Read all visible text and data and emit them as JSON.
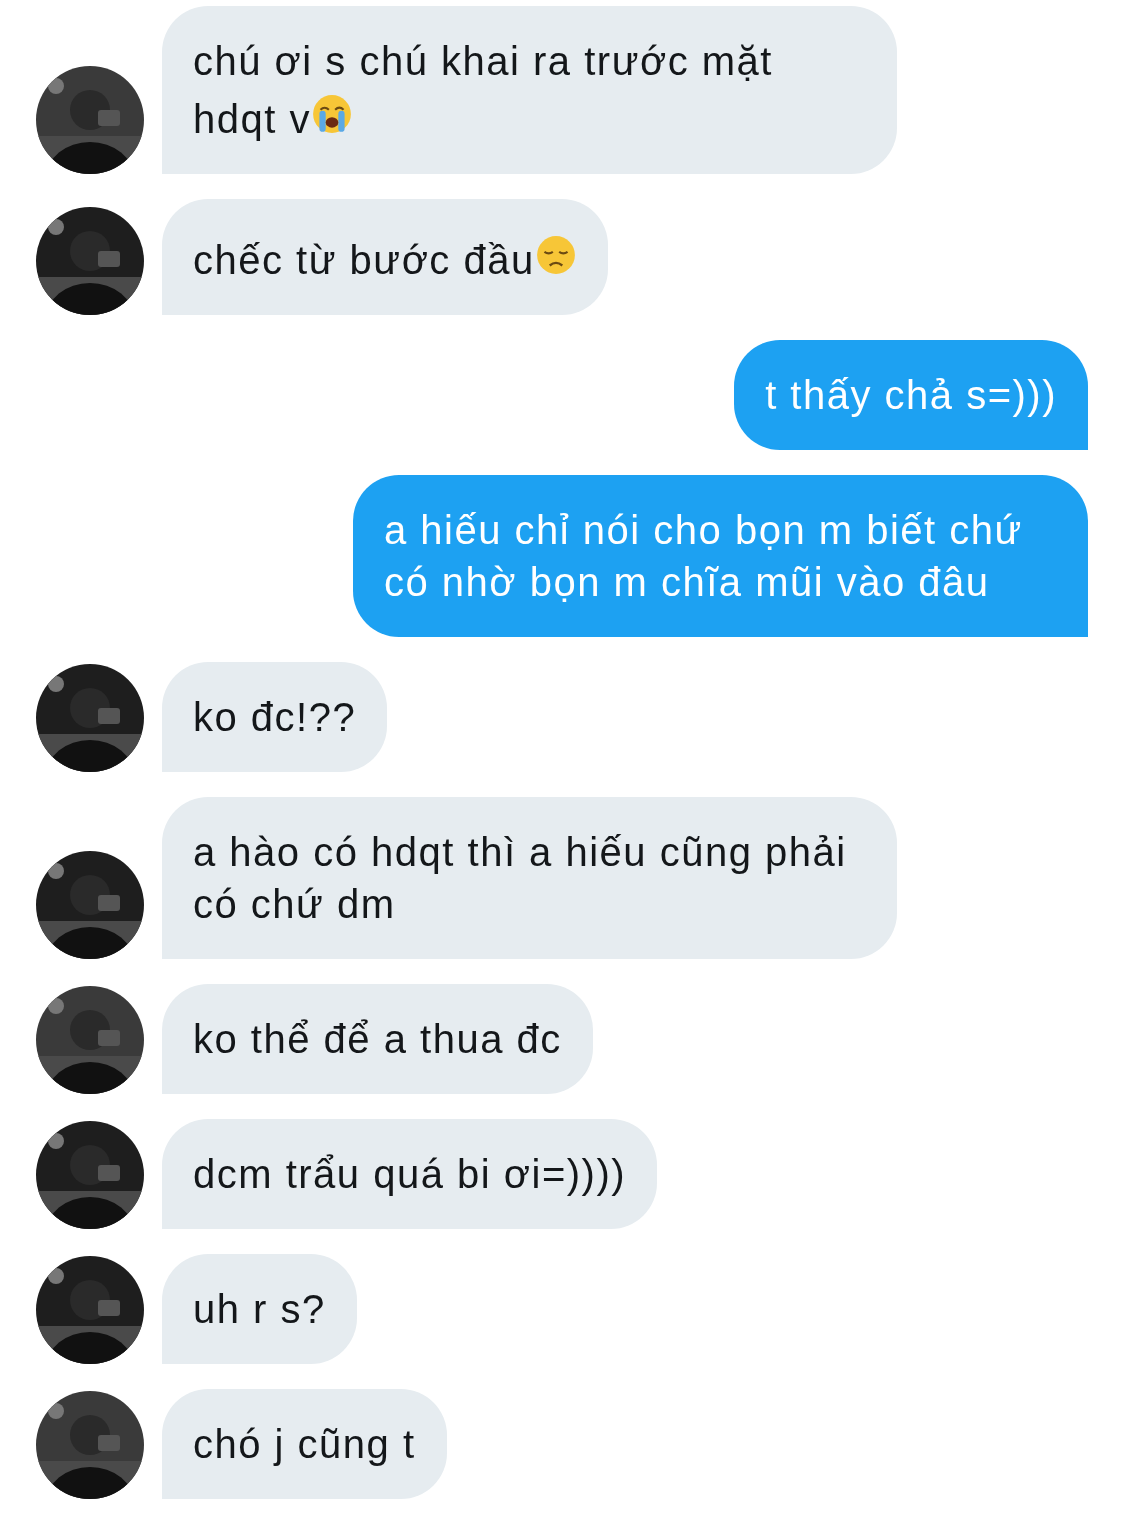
{
  "messages": [
    {
      "kind": "incoming",
      "text": "chú ơi s chú khai ra trước mặt hdqt v",
      "emoji": {
        "kind": "crying"
      }
    },
    {
      "kind": "incoming",
      "text": "chếc từ bước đầu",
      "emoji": {
        "kind": "sad"
      }
    },
    {
      "kind": "outgoing",
      "text": "t thấy chả s=)))"
    },
    {
      "kind": "outgoing",
      "text": "a hiếu chỉ nói cho bọn m biết chứ có nhờ bọn m chĩa mũi vào đâu"
    },
    {
      "kind": "incoming",
      "text": "ko đc!??"
    },
    {
      "kind": "incoming",
      "text": "a hào có hdqt thì a hiếu cũng phải có chứ dm"
    },
    {
      "kind": "incoming",
      "text": "ko thể để a thua đc"
    },
    {
      "kind": "incoming",
      "text": "dcm trẩu quá bi ơi=))))"
    },
    {
      "kind": "incoming",
      "text": "uh r s?"
    },
    {
      "kind": "incoming",
      "text": "chó j cũng t"
    }
  ]
}
